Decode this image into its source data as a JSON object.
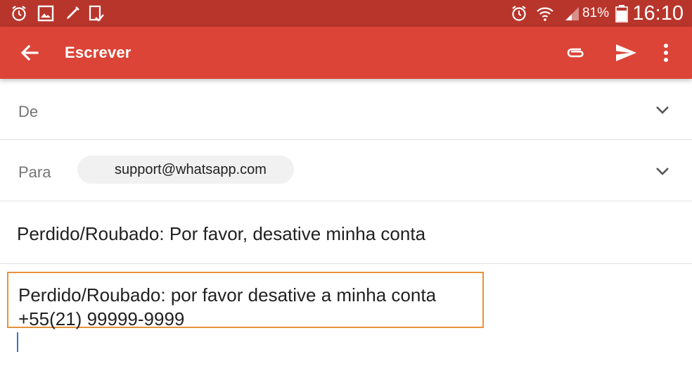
{
  "status_bar": {
    "icons_left": [
      "alarm-icon",
      "gallery-icon",
      "pen-icon",
      "tablet-check-icon"
    ],
    "icons_right": [
      "alarm-icon",
      "wifi-icon",
      "signal-icon",
      "battery-icon"
    ],
    "battery": "81%",
    "time": "16:10"
  },
  "app_bar": {
    "title": "Escrever",
    "actions": [
      "back-arrow-icon",
      "attach-icon",
      "send-icon",
      "more-vert-icon"
    ]
  },
  "compose": {
    "from_label": "De",
    "to_label": "Para",
    "to_recipient": "support@whatsapp.com",
    "subject": "Perdido/Roubado: Por favor, desative minha conta",
    "body_lines": [
      "Perdido/Roubado: por favor desative a minha conta",
      "+55(21) 99999-9999"
    ]
  },
  "colors": {
    "status_bar": "#b8352b",
    "app_bar": "#db4437",
    "highlight_box": "#e8923a",
    "cursor": "#3b6fd8"
  }
}
